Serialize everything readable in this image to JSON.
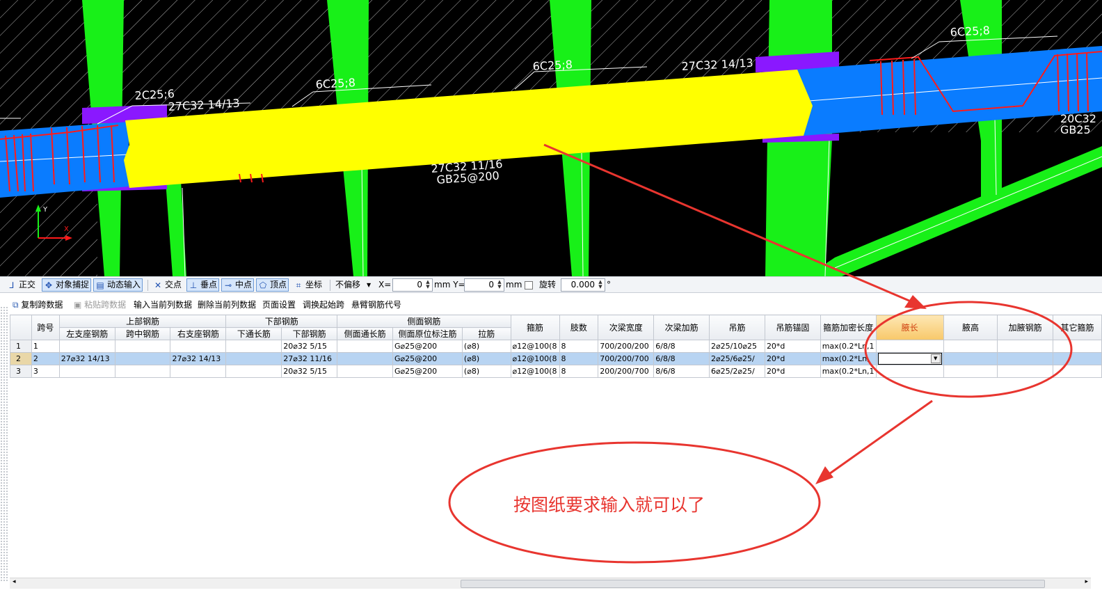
{
  "cad": {
    "labels": [
      "2C25;6",
      "27C32 14/13",
      "6C25;8",
      "6C25;8",
      "27C32 14/13",
      "6C25;8",
      "27C32 11/16",
      "GB25@200",
      "20C32",
      "GB25"
    ],
    "axis_x": "X",
    "axis_y": "Y"
  },
  "toolbar": {
    "ortho": "正交",
    "snap": "对象捕捉",
    "dyn_input": "动态输入",
    "intersect": "交点",
    "perp": "垂点",
    "mid": "中点",
    "vertex": "顶点",
    "coord": "坐标",
    "offset_select": "不偏移",
    "x_label": "X=",
    "x_value": "0",
    "y_label": "mm Y=",
    "y_value": "0",
    "mm": "mm",
    "rotate": "旋转",
    "rotate_value": "0.000",
    "degree": "°"
  },
  "toolbar2": {
    "copy_span": "复制跨数据",
    "paste_span": "粘贴跨数据",
    "input_col": "输入当前列数据",
    "delete_col": "删除当前列数据",
    "page_setup": "页面设置",
    "adjust_start": "调换起始跨",
    "cantilever": "悬臂钢筋代号"
  },
  "grid": {
    "group_headers": {
      "span_no": "跨号",
      "top_bar": "上部钢筋",
      "bottom_bar": "下部钢筋",
      "side_bar": "侧面钢筋",
      "stirrup": "箍筋",
      "legs": "肢数",
      "beam_width": "次梁宽度",
      "beam_add": "次梁加筋",
      "hanger": "吊筋",
      "hanger_anchor": "吊筋锚固",
      "dense_len": "箍筋加密长度",
      "haunch_len": "腋长",
      "haunch_h": "腋高",
      "haunch_bar": "加腋钢筋",
      "other_stirrup": "其它箍筋"
    },
    "sub_headers": {
      "left_support": "左支座钢筋",
      "mid_span": "跨中钢筋",
      "right_support": "右支座钢筋",
      "bottom_through": "下通长筋",
      "bottom_bar": "下部钢筋",
      "side_through": "侧面通长筋",
      "side_orig": "侧面原位标注筋",
      "tie": "拉筋"
    },
    "rows": [
      {
        "n": "1",
        "span": "1",
        "left": "",
        "mid": "",
        "right": "",
        "bt": "",
        "bb": "20⌀32 5/15",
        "st": "",
        "so": "G⌀25@200",
        "tie": "(⌀8)",
        "stir": "⌀12@100(8",
        "legs": "8",
        "bw": "700/200/200",
        "ba": "6/8/8",
        "hang": "2⌀25/10⌀25",
        "ha": "20*d",
        "dl": "max(0.2*Ln,1",
        "hl": "",
        "hh": "",
        "hb": "",
        "os": ""
      },
      {
        "n": "2",
        "span": "2",
        "left": "27⌀32 14/13",
        "mid": "",
        "right": "27⌀32 14/13",
        "bt": "",
        "bb": "27⌀32 11/16",
        "st": "",
        "so": "G⌀25@200",
        "tie": "(⌀8)",
        "stir": "⌀12@100(8",
        "legs": "8",
        "bw": "700/200/700",
        "ba": "6/8/8",
        "hang": "2⌀25/6⌀25/",
        "ha": "20*d",
        "dl": "max(0.2*Ln,",
        "hl": "",
        "hh": "",
        "hb": "",
        "os": ""
      },
      {
        "n": "3",
        "span": "3",
        "left": "",
        "mid": "",
        "right": "",
        "bt": "",
        "bb": "20⌀32 5/15",
        "st": "",
        "so": "G⌀25@200",
        "tie": "(⌀8)",
        "stir": "⌀12@100(8",
        "legs": "8",
        "bw": "200/200/700",
        "ba": "8/6/8",
        "hang": "6⌀25/2⌀25/",
        "ha": "20*d",
        "dl": "max(0.2*Ln,1",
        "hl": "",
        "hh": "",
        "hb": "",
        "os": ""
      }
    ]
  },
  "annotation": {
    "note": "按图纸要求输入就可以了",
    "color": "#e8352f"
  },
  "colors": {
    "beam_yellow": "#ffff00",
    "beam_blue": "#0a7cff",
    "column_green": "#18f018",
    "support_purple": "#8a18ff",
    "rebar_red": "#ff1a1a",
    "select_row": "#b8d4f2"
  }
}
